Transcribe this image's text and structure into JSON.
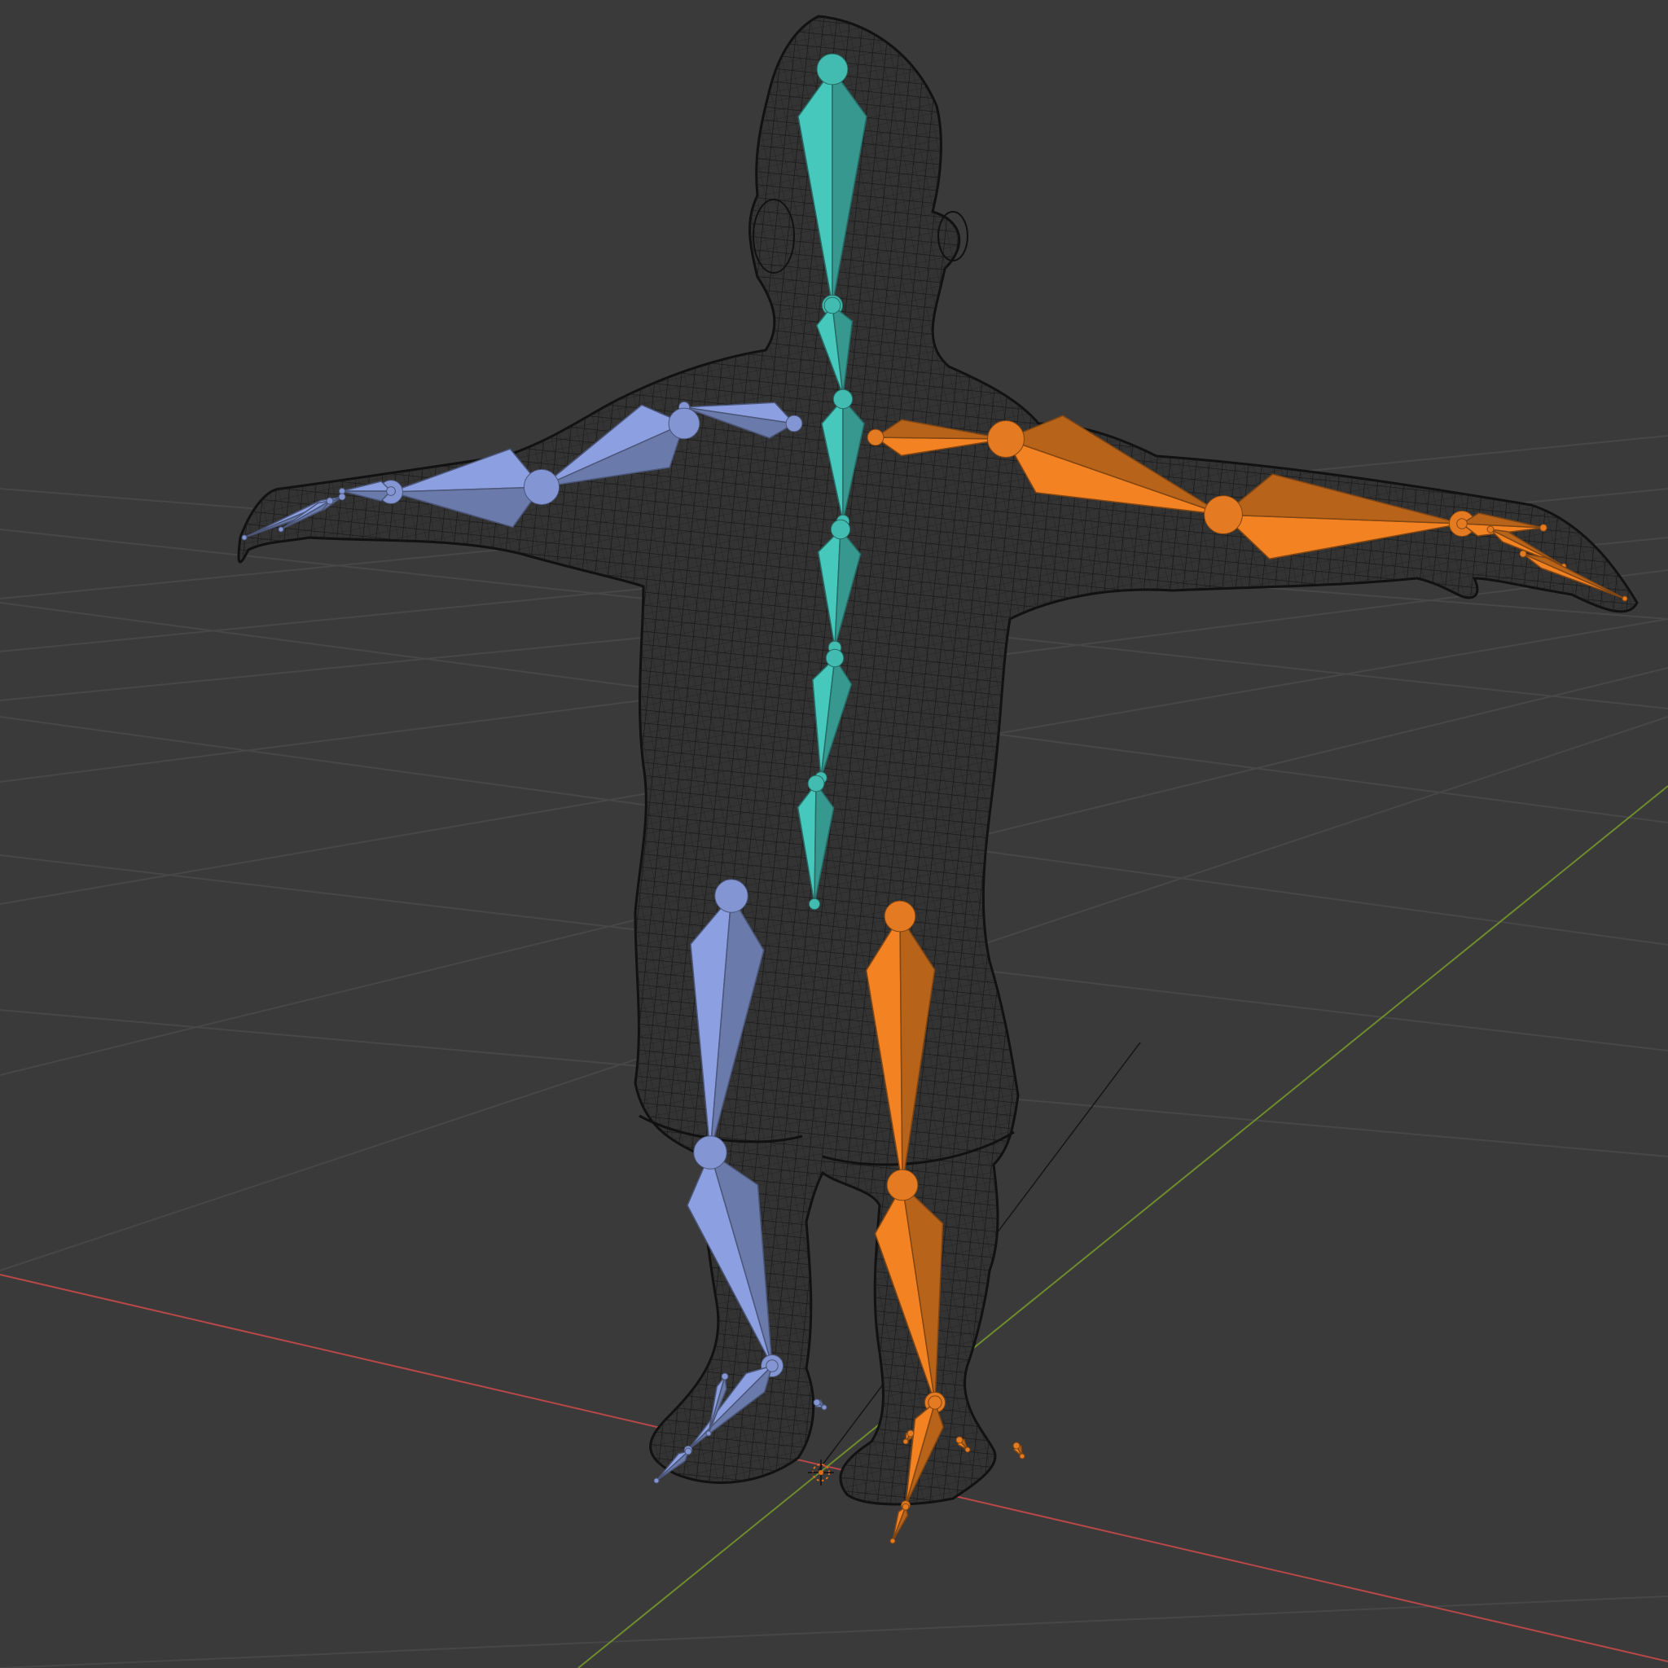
{
  "viewport": {
    "background": "#3a3a3a",
    "grid_color": "#484848",
    "x_axis_color": "#b84848",
    "y_axis_color": "#6e8c2c",
    "mesh_color": "#141414",
    "mesh_fill": "#353535"
  },
  "armature": {
    "spine_color": "#3fb3a8",
    "left_side_color": "#7d8fc9",
    "right_side_color": "#d9741f",
    "spine_bones": [
      "head",
      "neck",
      "chest",
      "spine-upper",
      "spine-mid",
      "spine-lower",
      "hips"
    ],
    "left_bones": [
      "shoulder",
      "upper-arm",
      "forearm",
      "hand",
      "thigh",
      "shin",
      "foot",
      "toe"
    ],
    "right_bones": [
      "shoulder",
      "upper-arm",
      "forearm",
      "hand",
      "thigh",
      "shin",
      "foot",
      "toe"
    ]
  },
  "scene_cursor": {
    "icon": "3d-cursor-icon",
    "color": "#e06a1a"
  }
}
